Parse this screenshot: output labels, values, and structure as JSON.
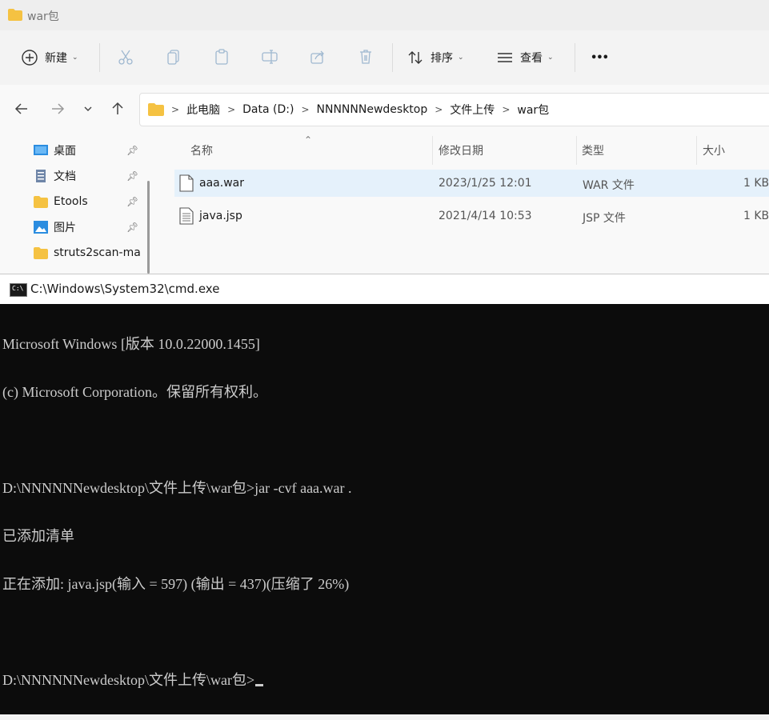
{
  "explorer": {
    "title": "war包",
    "toolbar": {
      "new_label": "新建",
      "sort_label": "排序",
      "view_label": "查看",
      "more_label": "•••"
    },
    "nav": {
      "back_icon": "arrow-left-icon",
      "forward_icon": "arrow-right-icon",
      "recent_icon": "chevron-down-icon",
      "up_icon": "arrow-up-icon"
    },
    "breadcrumbs": [
      "此电脑",
      "Data (D:)",
      "NNNNNNewdesktop",
      "文件上传",
      "war包"
    ],
    "sidebar": {
      "items": [
        {
          "label": "桌面",
          "icon": "desktop-icon",
          "pinned": true
        },
        {
          "label": "文档",
          "icon": "document-icon",
          "pinned": true
        },
        {
          "label": "Etools",
          "icon": "folder-icon",
          "pinned": true
        },
        {
          "label": "图片",
          "icon": "picture-icon",
          "pinned": true
        },
        {
          "label": "struts2scan-ma",
          "icon": "folder-icon",
          "pinned": false
        }
      ]
    },
    "columns": {
      "name": "名称",
      "modified": "修改日期",
      "type": "类型",
      "size": "大小"
    },
    "files": [
      {
        "name": "aaa.war",
        "modified": "2023/1/25 12:01",
        "type": "WAR 文件",
        "size": "1 KB",
        "selected": true
      },
      {
        "name": "java.jsp",
        "modified": "2021/4/14 10:53",
        "type": "JSP 文件",
        "size": "1 KB",
        "selected": false
      }
    ]
  },
  "cmd": {
    "title": "C:\\Windows\\System32\\cmd.exe",
    "lines": [
      "Microsoft Windows [版本 10.0.22000.1455]",
      "(c) Microsoft Corporation。保留所有权利。",
      "",
      "D:\\NNNNNNewdesktop\\文件上传\\war包>jar -cvf aaa.war .",
      "已添加清单",
      "正在添加: java.jsp(输入 = 597) (输出 = 437)(压缩了 26%)",
      "",
      "D:\\NNNNNNewdesktop\\文件上传\\war包>"
    ]
  },
  "colors": {
    "selected_row": "#e5f1fb",
    "folder": "#f5c242",
    "console_bg": "#0c0c0c",
    "console_text": "#cccccc"
  }
}
